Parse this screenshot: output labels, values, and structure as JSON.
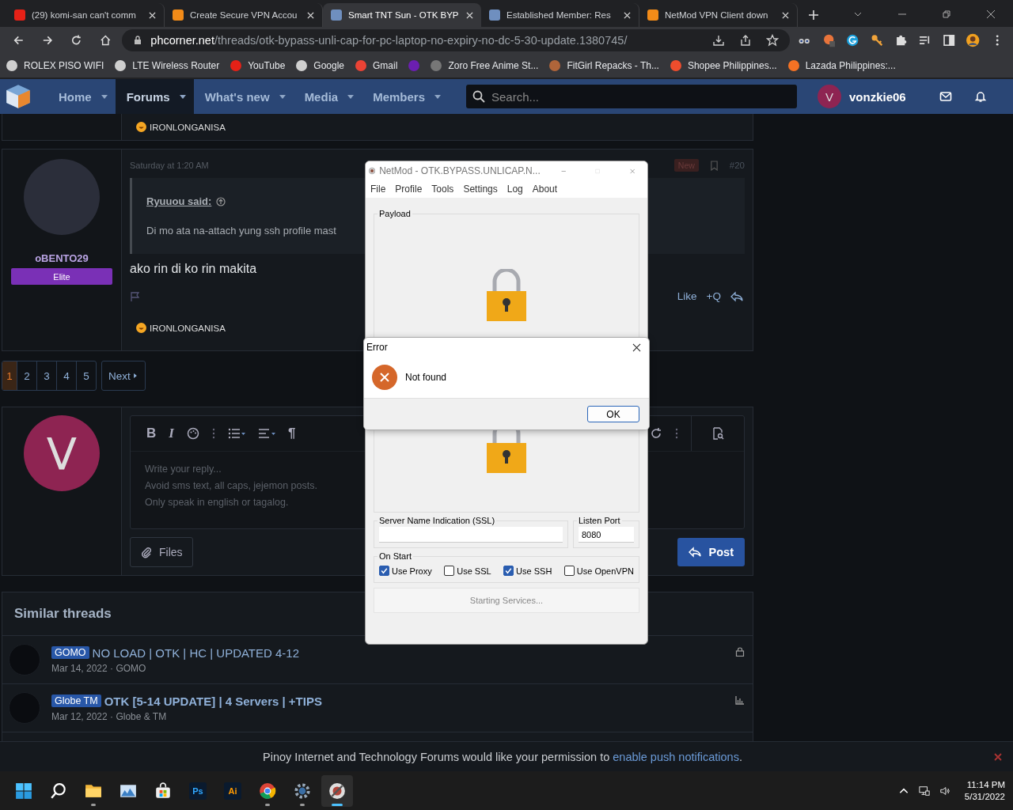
{
  "browser": {
    "tabs": [
      {
        "title": "(29) komi-san can't comm",
        "selected": false
      },
      {
        "title": "Create Secure VPN Accou",
        "selected": false
      },
      {
        "title": "Smart TNT Sun - OTK BYP",
        "selected": true
      },
      {
        "title": "Established Member: Res",
        "selected": false
      },
      {
        "title": "NetMod VPN Client down",
        "selected": false
      }
    ],
    "url_domain": "phcorner.net",
    "url_path": "/threads/otk-bypass-unli-cap-for-pc-laptop-no-expiry-no-dc-5-30-update.1380745/",
    "bookmarks": [
      {
        "kind": "text",
        "title": "ROLEX PISO WIFI"
      },
      {
        "kind": "text",
        "title": "LTE Wireless Router"
      },
      {
        "kind": "text",
        "title": "YouTube"
      },
      {
        "kind": "text",
        "title": "Google"
      },
      {
        "kind": "text",
        "title": "Gmail"
      },
      {
        "kind": "icon"
      },
      {
        "kind": "text",
        "title": "Zoro Free Anime St..."
      },
      {
        "kind": "text",
        "title": "FitGirl Repacks - Th..."
      },
      {
        "kind": "text",
        "title": "Shopee Philippines..."
      },
      {
        "kind": "text",
        "title": "Lazada Philippines:..."
      }
    ]
  },
  "nav": {
    "items": [
      {
        "label": "Home",
        "selected": false
      },
      {
        "label": "Forums",
        "selected": true
      },
      {
        "label": "What's new",
        "selected": false
      },
      {
        "label": "Media",
        "selected": false
      },
      {
        "label": "Members",
        "selected": false
      }
    ],
    "search_placeholder": "Search...",
    "avatar_letter": "V",
    "username": "vonzkie06"
  },
  "previous_post": {
    "reaction": "IRONLONGANISA"
  },
  "post": {
    "username": "oBENTO29",
    "rank": "Elite",
    "date": "Saturday at 1:20 AM",
    "badge": "New",
    "number": "#20",
    "quote_author": "Ryuuou said:",
    "quote_text": "Di mo ata na-attach yung ssh profile mast",
    "body": "ako rin di ko rin makita",
    "actions": [
      "Like",
      "+Q"
    ],
    "reaction": "IRONLONGANISA"
  },
  "pagination": {
    "pages": [
      {
        "label": "1",
        "selected": true
      },
      {
        "label": "2",
        "selected": false
      },
      {
        "label": "3",
        "selected": false
      },
      {
        "label": "4",
        "selected": false
      },
      {
        "label": "5",
        "selected": false
      }
    ],
    "next": "Next"
  },
  "reply": {
    "avatar_letter": "V",
    "toolbar": [
      {
        "kind": "text",
        "label": "B"
      },
      {
        "kind": "text",
        "label": "I"
      },
      {
        "kind": "palette"
      },
      {
        "kind": "more"
      },
      {
        "kind": "list"
      },
      {
        "kind": "align"
      },
      {
        "kind": "text",
        "label": "¶"
      }
    ],
    "placeholder": "Write your reply...\nAvoid sms text, all caps, jejemon posts.\nOnly speak in english or tagalog.",
    "files_button": "Files",
    "post_button": "Post"
  },
  "similar": {
    "title": "Similar threads",
    "threads": [
      {
        "prefix": "GOMO",
        "title": "NO LOAD | OTK | HC | UPDATED 4-12",
        "meta": "Mar 14, 2022 · GOMO",
        "unread": false,
        "kind": "locked"
      },
      {
        "prefix": "Globe TM",
        "title": "OTK [5-14 UPDATE] | 4 Servers | +TIPS",
        "meta": "Mar 12, 2022 · Globe & TM",
        "unread": true,
        "kind": "chart"
      }
    ]
  },
  "notice": {
    "text": "Pinoy Internet and Technology Forums would like your permission to ",
    "link": "enable push notifications",
    "end": "."
  },
  "netmod": {
    "title": "NetMod - OTK.BYPASS.UNLICAP.N...",
    "menu": [
      "File",
      "Profile",
      "Tools",
      "Settings",
      "Log",
      "About"
    ],
    "payload_label": "Payload",
    "sni_label": "Server Name Indication (SSL)",
    "port_label": "Listen Port",
    "port": "8080",
    "on_start_label": "On Start",
    "options": [
      {
        "label": "Use Proxy",
        "checked": true
      },
      {
        "label": "Use SSL",
        "checked": false
      },
      {
        "label": "Use SSH",
        "checked": true
      },
      {
        "label": "Use OpenVPN",
        "checked": false
      }
    ],
    "status": "Starting Services..."
  },
  "error_dialog": {
    "title": "Error",
    "message": "Not found",
    "button": "OK"
  },
  "taskbar": {
    "apps": [
      {
        "kind": "start",
        "running": false,
        "selected": false
      },
      {
        "kind": "search",
        "running": false,
        "selected": false
      },
      {
        "kind": "folder",
        "running": true,
        "selected": false
      },
      {
        "kind": "photos",
        "running": false,
        "selected": false
      },
      {
        "kind": "store",
        "running": false,
        "selected": false
      },
      {
        "kind": "badge",
        "label": "Ps",
        "running": false,
        "selected": false
      },
      {
        "kind": "badge",
        "label": "Ai",
        "running": false,
        "selected": false
      },
      {
        "kind": "chrome",
        "running": true,
        "selected": false
      },
      {
        "kind": "gear",
        "running": true,
        "selected": false
      },
      {
        "kind": "netmod",
        "running": true,
        "selected": true
      }
    ],
    "time": "11:14 PM",
    "date": "5/31/2022"
  }
}
